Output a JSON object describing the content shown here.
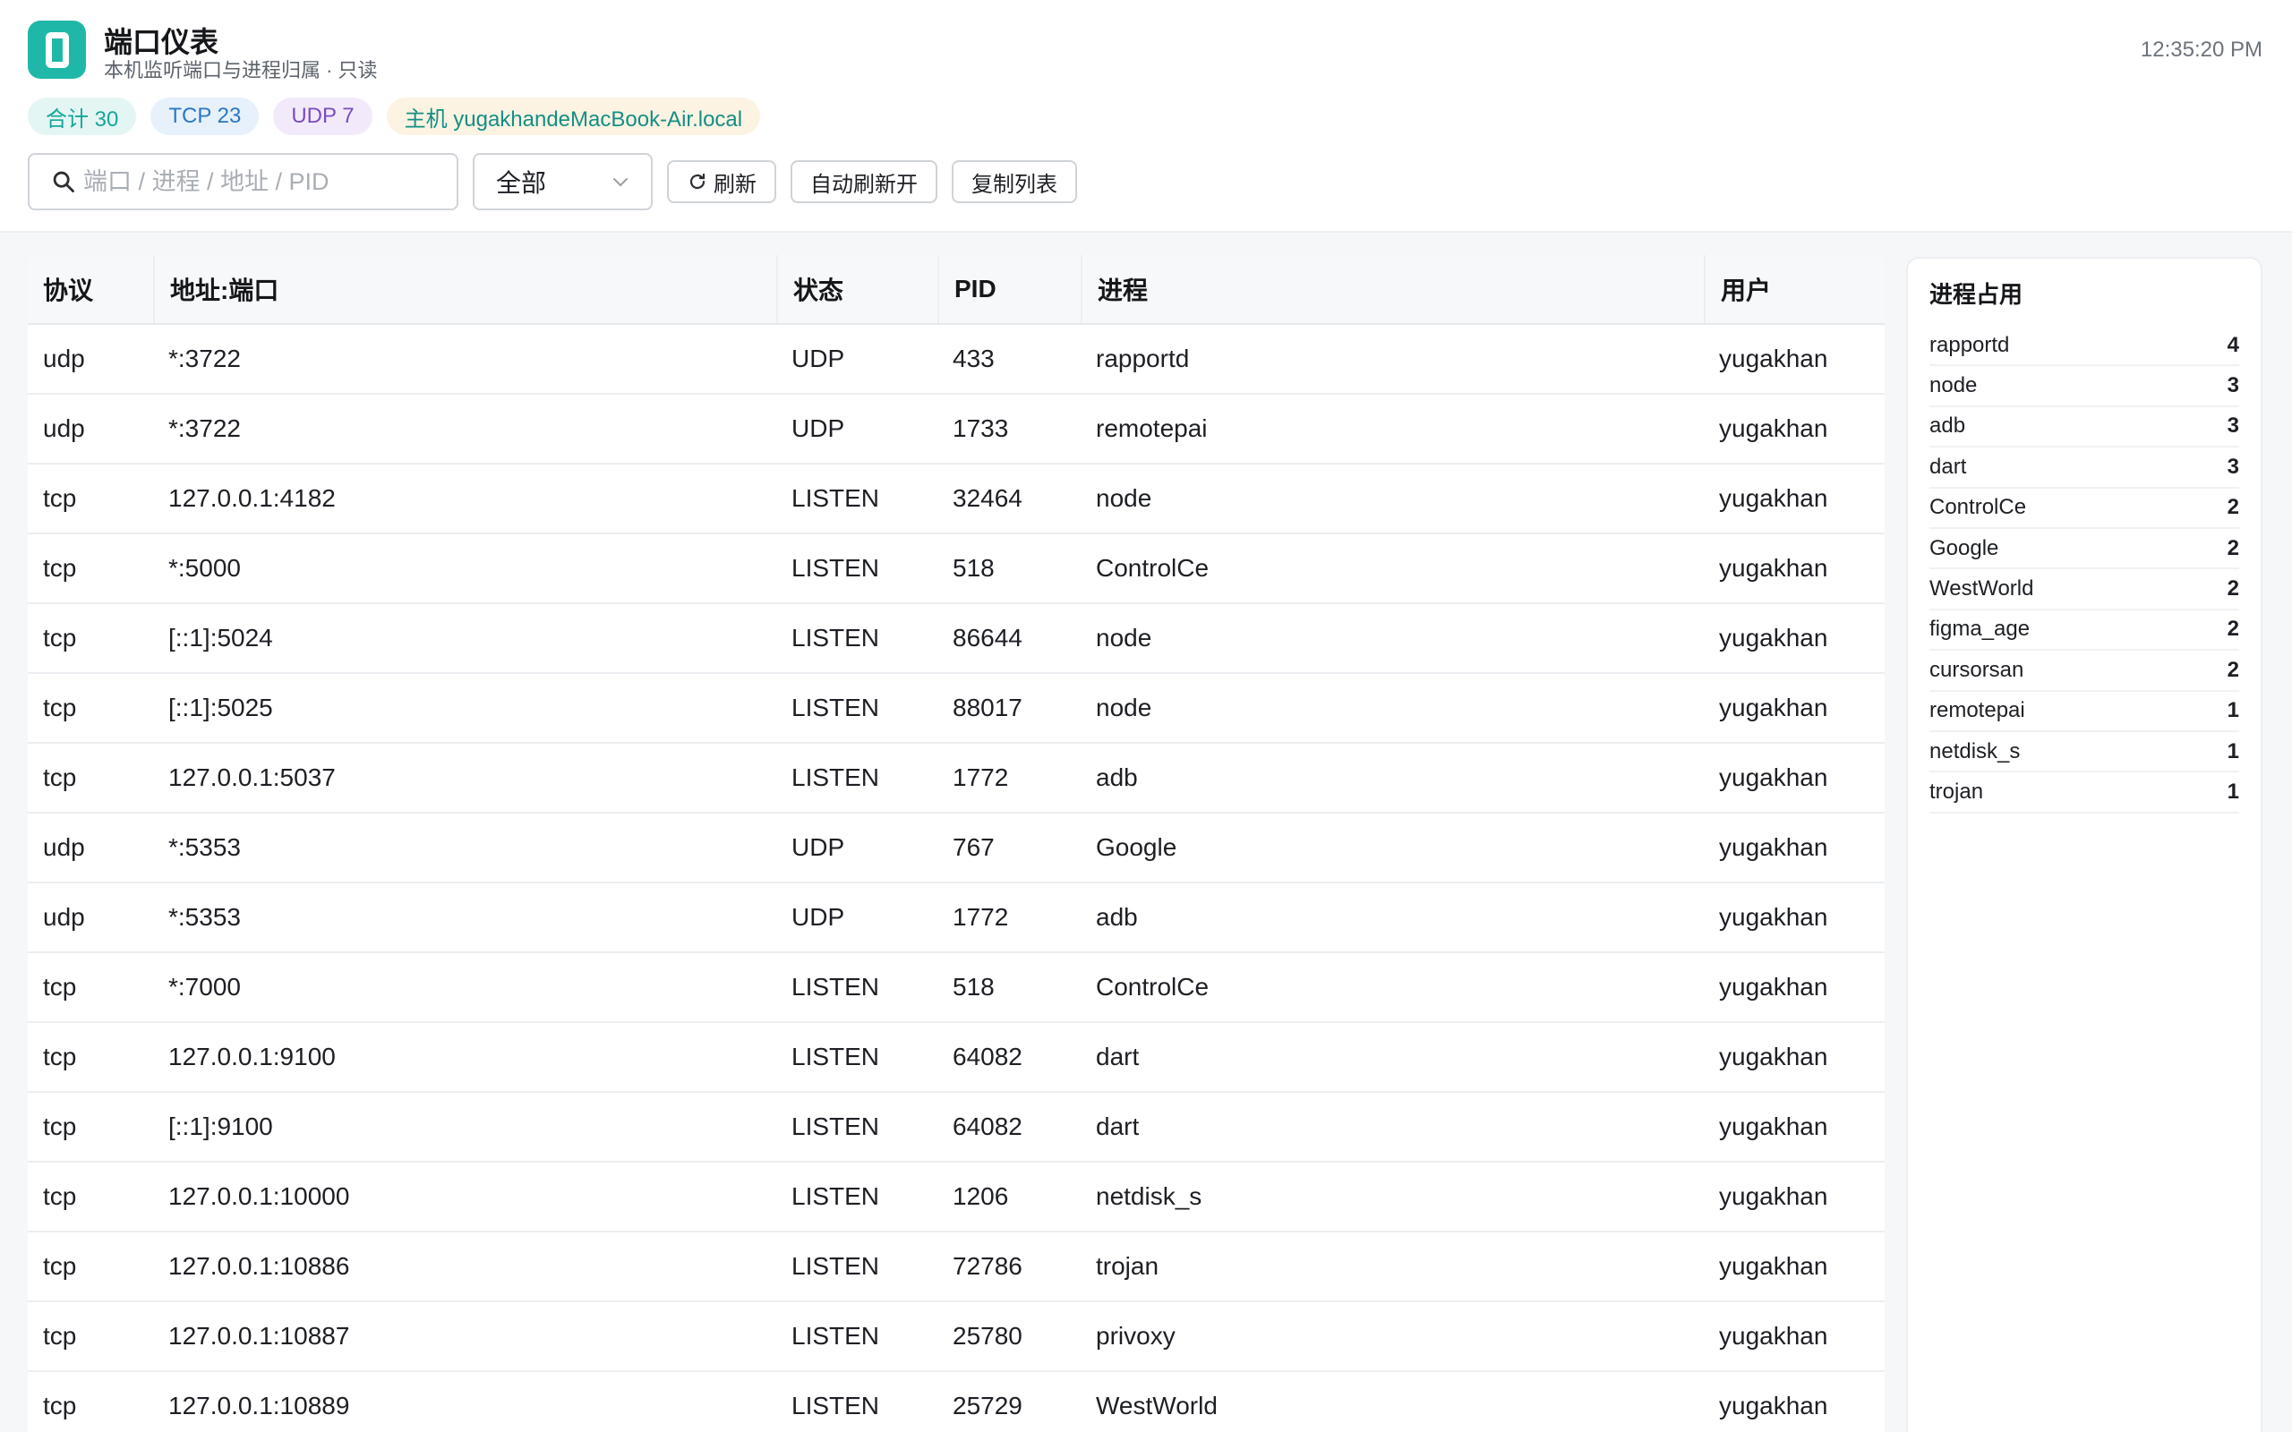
{
  "app": {
    "title": "端口仪表",
    "subtitle": "本机监听端口与进程归属 · 只读",
    "time": "12:35:20 PM",
    "accent_color": "#1fb8a8"
  },
  "pills": {
    "total": "合计 30",
    "tcp": "TCP 23",
    "udp": "UDP 7",
    "host": "主机 yugakhandeMacBook-Air.local"
  },
  "toolbar": {
    "search_value": "",
    "search_placeholder": "端口 / 进程 / 地址 / PID",
    "filter_selected": "全部",
    "refresh_label": "刷新",
    "auto_refresh_label": "自动刷新开",
    "copy_label": "复制列表"
  },
  "table": {
    "headers": {
      "proto": "协议",
      "addr": "地址:端口",
      "state": "状态",
      "pid": "PID",
      "process": "进程",
      "user": "用户"
    },
    "rows": [
      {
        "proto": "udp",
        "addr": "*:3722",
        "state": "UDP",
        "pid": "433",
        "process": "rapportd",
        "user": "yugakhan"
      },
      {
        "proto": "udp",
        "addr": "*:3722",
        "state": "UDP",
        "pid": "1733",
        "process": "remotepai",
        "user": "yugakhan"
      },
      {
        "proto": "tcp",
        "addr": "127.0.0.1:4182",
        "state": "LISTEN",
        "pid": "32464",
        "process": "node",
        "user": "yugakhan"
      },
      {
        "proto": "tcp",
        "addr": "*:5000",
        "state": "LISTEN",
        "pid": "518",
        "process": "ControlCe",
        "user": "yugakhan"
      },
      {
        "proto": "tcp",
        "addr": "[::1]:5024",
        "state": "LISTEN",
        "pid": "86644",
        "process": "node",
        "user": "yugakhan"
      },
      {
        "proto": "tcp",
        "addr": "[::1]:5025",
        "state": "LISTEN",
        "pid": "88017",
        "process": "node",
        "user": "yugakhan"
      },
      {
        "proto": "tcp",
        "addr": "127.0.0.1:5037",
        "state": "LISTEN",
        "pid": "1772",
        "process": "adb",
        "user": "yugakhan"
      },
      {
        "proto": "udp",
        "addr": "*:5353",
        "state": "UDP",
        "pid": "767",
        "process": "Google",
        "user": "yugakhan"
      },
      {
        "proto": "udp",
        "addr": "*:5353",
        "state": "UDP",
        "pid": "1772",
        "process": "adb",
        "user": "yugakhan"
      },
      {
        "proto": "tcp",
        "addr": "*:7000",
        "state": "LISTEN",
        "pid": "518",
        "process": "ControlCe",
        "user": "yugakhan"
      },
      {
        "proto": "tcp",
        "addr": "127.0.0.1:9100",
        "state": "LISTEN",
        "pid": "64082",
        "process": "dart",
        "user": "yugakhan"
      },
      {
        "proto": "tcp",
        "addr": "[::1]:9100",
        "state": "LISTEN",
        "pid": "64082",
        "process": "dart",
        "user": "yugakhan"
      },
      {
        "proto": "tcp",
        "addr": "127.0.0.1:10000",
        "state": "LISTEN",
        "pid": "1206",
        "process": "netdisk_s",
        "user": "yugakhan"
      },
      {
        "proto": "tcp",
        "addr": "127.0.0.1:10886",
        "state": "LISTEN",
        "pid": "72786",
        "process": "trojan",
        "user": "yugakhan"
      },
      {
        "proto": "tcp",
        "addr": "127.0.0.1:10887",
        "state": "LISTEN",
        "pid": "25780",
        "process": "privoxy",
        "user": "yugakhan"
      },
      {
        "proto": "tcp",
        "addr": "127.0.0.1:10889",
        "state": "LISTEN",
        "pid": "25729",
        "process": "WestWorld",
        "user": "yugakhan"
      }
    ]
  },
  "sidebar": {
    "title": "进程占用",
    "items": [
      {
        "name": "rapportd",
        "count": "4"
      },
      {
        "name": "node",
        "count": "3"
      },
      {
        "name": "adb",
        "count": "3"
      },
      {
        "name": "dart",
        "count": "3"
      },
      {
        "name": "ControlCe",
        "count": "2"
      },
      {
        "name": "Google",
        "count": "2"
      },
      {
        "name": "WestWorld",
        "count": "2"
      },
      {
        "name": "figma_age",
        "count": "2"
      },
      {
        "name": "cursorsan",
        "count": "2"
      },
      {
        "name": "remotepai",
        "count": "1"
      },
      {
        "name": "netdisk_s",
        "count": "1"
      },
      {
        "name": "trojan",
        "count": "1"
      }
    ]
  },
  "icons": {
    "app": "port-dashboard-icon",
    "search": "search-icon",
    "select": "chevron-down-icon",
    "refresh": "refresh-icon"
  }
}
